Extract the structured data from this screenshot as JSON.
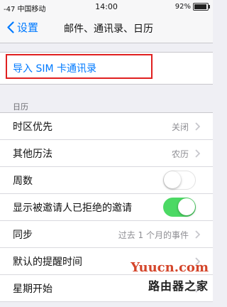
{
  "status_bar": {
    "carrier": "-47 中国移动",
    "time": "14:00",
    "battery": "92%",
    "battery_level": 0.92
  },
  "nav": {
    "back_label": "设置",
    "title": "邮件、通讯录、日历"
  },
  "import": {
    "label": "导入 SIM 卡通讯录"
  },
  "calendar_section": {
    "header": "日历",
    "rows": [
      {
        "label": "时区优先",
        "value": "关闭",
        "type": "disclosure"
      },
      {
        "label": "其他历法",
        "value": "农历",
        "type": "disclosure"
      },
      {
        "label": "周数",
        "type": "switch",
        "on": false
      },
      {
        "label": "显示被邀请人已拒绝的邀请",
        "type": "switch",
        "on": true
      },
      {
        "label": "同步",
        "value": "过去 1 个月的事件",
        "type": "disclosure"
      },
      {
        "label": "默认的提醒时间",
        "type": "disclosure"
      },
      {
        "label": "星期开始",
        "type": "disclosure"
      }
    ]
  },
  "watermark": {
    "line1": "Yuucn.com",
    "line2": "路由器之家"
  },
  "colors": {
    "accent": "#007aff",
    "switch_on": "#4cd964",
    "highlight": "#e02020"
  }
}
